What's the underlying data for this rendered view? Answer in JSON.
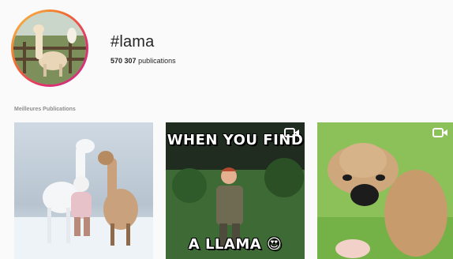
{
  "profile": {
    "hashtag": "#lama",
    "post_count_number": "570 307",
    "post_count_label": "publications"
  },
  "section": {
    "title": "Meilleures Publications"
  },
  "posts": [
    {
      "type": "image",
      "icon": "none"
    },
    {
      "type": "video",
      "icon": "video-camera-icon",
      "caption_top": "WHEN YOU FIND",
      "caption_bottom": "A LLAMA",
      "emoji": "😍"
    },
    {
      "type": "video",
      "icon": "video-camera-icon"
    }
  ],
  "colors": {
    "background": "#fafafa",
    "text": "#262626",
    "muted": "#8e8e8e",
    "ring_gradient": [
      "#f9c74f",
      "#f3722c",
      "#e1306c",
      "#c13584"
    ]
  }
}
